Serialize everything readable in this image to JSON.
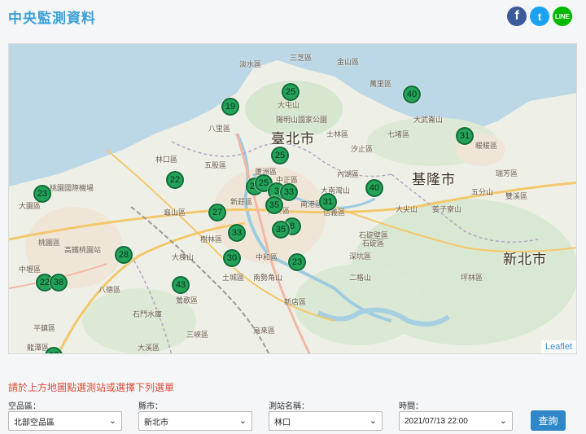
{
  "header": {
    "title": "中央監測資料",
    "facebook_icon": "f",
    "twitter_icon": "t",
    "line_label": "LINE"
  },
  "map": {
    "cities": [
      "臺北市",
      "基隆市",
      "新北市"
    ],
    "districts": [
      "淡水區",
      "三芝區",
      "金山區",
      "萬里區",
      "大屯山",
      "陽明山國家公園",
      "八里區",
      "士林區",
      "七堵區",
      "大武崙山",
      "林口區",
      "五股區",
      "汐止區",
      "內湖區",
      "暖暖區",
      "瑞芳區",
      "大園區",
      "桃園國際機場",
      "龜山區",
      "大南灣山",
      "中正區",
      "新莊區",
      "大尖山",
      "五分山",
      "姜子寮山",
      "桃園區",
      "石碇區",
      "石碇壁區",
      "雙溪區",
      "蘆洲區",
      "大安區",
      "南港區",
      "信義區",
      "中和區",
      "深坑區",
      "二格山",
      "坪林區",
      "土城區",
      "南勢角山",
      "新店區",
      "烏來區",
      "平鎮區",
      "龍潭區",
      "三峽區",
      "大溪區",
      "鶯歌區",
      "八德區",
      "中壢區",
      "高鐵桃園站",
      "樹林區",
      "大棟山",
      "石門水庫"
    ],
    "markers": [
      {
        "label": "25"
      },
      {
        "label": "40"
      },
      {
        "label": "19"
      },
      {
        "label": "31"
      },
      {
        "label": "25"
      },
      {
        "label": "23"
      },
      {
        "label": "22"
      },
      {
        "label": "27"
      },
      {
        "label": "25"
      },
      {
        "label": "3"
      },
      {
        "label": "33"
      },
      {
        "label": "40"
      },
      {
        "label": "31"
      },
      {
        "label": "35"
      },
      {
        "label": "27"
      },
      {
        "label": "8"
      },
      {
        "label": "35"
      },
      {
        "label": "33"
      },
      {
        "label": "28"
      },
      {
        "label": "30"
      },
      {
        "label": "23"
      },
      {
        "label": "22"
      },
      {
        "label": "38"
      },
      {
        "label": "43"
      },
      {
        "label": "27"
      }
    ],
    "attribution": "Leaflet"
  },
  "form": {
    "hint": "請於上方地圖點選測站或選擇下列選單",
    "fields": [
      {
        "label": "空品區：",
        "value": "北部空品區"
      },
      {
        "label": "縣市：",
        "value": "新北市"
      },
      {
        "label": "測站名稱：",
        "value": "林口"
      },
      {
        "label": "時間：",
        "value": "2021/07/13 22:00"
      }
    ],
    "query_label": "查詢"
  },
  "colors": {
    "accent": "#3a9fd6",
    "marker_fill": "#23a35a",
    "marker_border": "#136b36",
    "hint_red": "#e04a3a",
    "button": "#2e87c8"
  }
}
